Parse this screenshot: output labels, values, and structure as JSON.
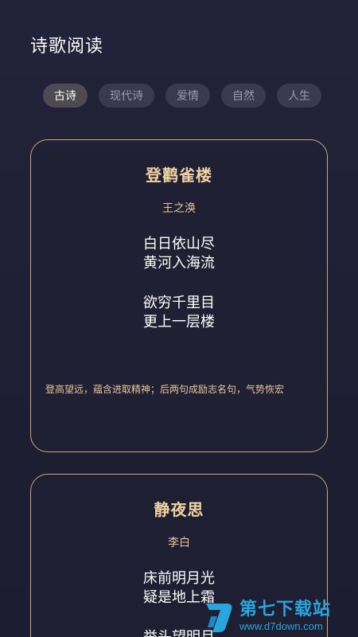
{
  "header": {
    "title": "诗歌阅读"
  },
  "tabs": [
    {
      "label": "古诗",
      "active": true
    },
    {
      "label": "现代诗",
      "active": false
    },
    {
      "label": "爱情",
      "active": false
    },
    {
      "label": "自然",
      "active": false
    },
    {
      "label": "人生",
      "active": false
    }
  ],
  "poems": [
    {
      "title": "登鹳雀楼",
      "author": "王之涣",
      "stanzas": [
        [
          "白日依山尽",
          "黄河入海流"
        ],
        [
          "欲穷千里目",
          "更上一层楼"
        ]
      ],
      "note": "登高望远，蕴含进取精神；后两句成励志名句，气势恢宏"
    },
    {
      "title": "静夜思",
      "author": "李白",
      "stanzas": [
        [
          "床前明月光",
          "疑是地上霜"
        ],
        [
          "举头望明月"
        ]
      ]
    }
  ],
  "watermark": {
    "main": "第七下载站",
    "sub": "www.d7down.com",
    "icon": "d7-logo-icon"
  },
  "colors": {
    "accent": "#c9a87a",
    "title": "#f1d3a3",
    "background": "#22223a",
    "watermark": "#2aa6de"
  }
}
